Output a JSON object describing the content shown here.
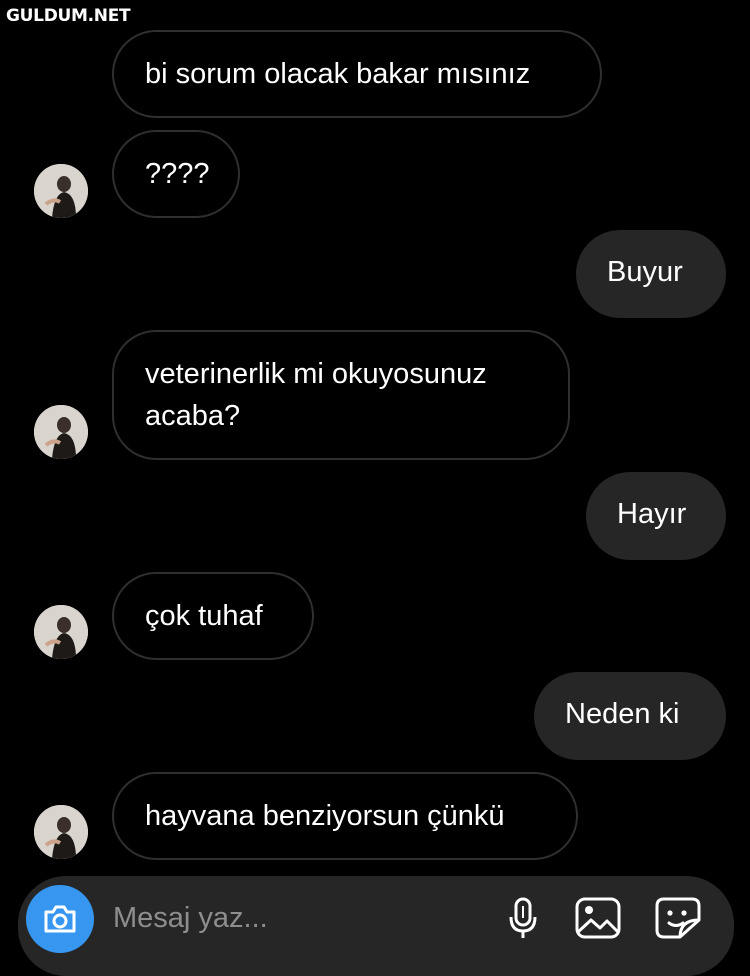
{
  "watermark": "GULDUM.NET",
  "messages": [
    {
      "side": "incoming",
      "text": "bi sorum olacak bakar mısınız"
    },
    {
      "side": "incoming",
      "text": "????"
    },
    {
      "side": "outgoing",
      "text": "Buyur"
    },
    {
      "side": "incoming",
      "text_lines": [
        "veterinerlik mi okuyosunuz",
        "acaba?"
      ]
    },
    {
      "side": "outgoing",
      "text": "Hayır"
    },
    {
      "side": "incoming",
      "text": "çok tuhaf"
    },
    {
      "side": "outgoing",
      "text": "Neden ki"
    },
    {
      "side": "incoming",
      "text": "hayvana benziyorsun çünkü"
    }
  ],
  "composer": {
    "placeholder": "Mesaj yaz...",
    "icons": [
      "camera-icon",
      "microphone-icon",
      "gallery-icon",
      "sticker-icon"
    ]
  },
  "colors": {
    "background": "#000000",
    "outgoing_bubble": "#262626",
    "incoming_border": "#2f2f2f",
    "camera_button": "#3797f0",
    "placeholder": "#8e8e8e"
  }
}
